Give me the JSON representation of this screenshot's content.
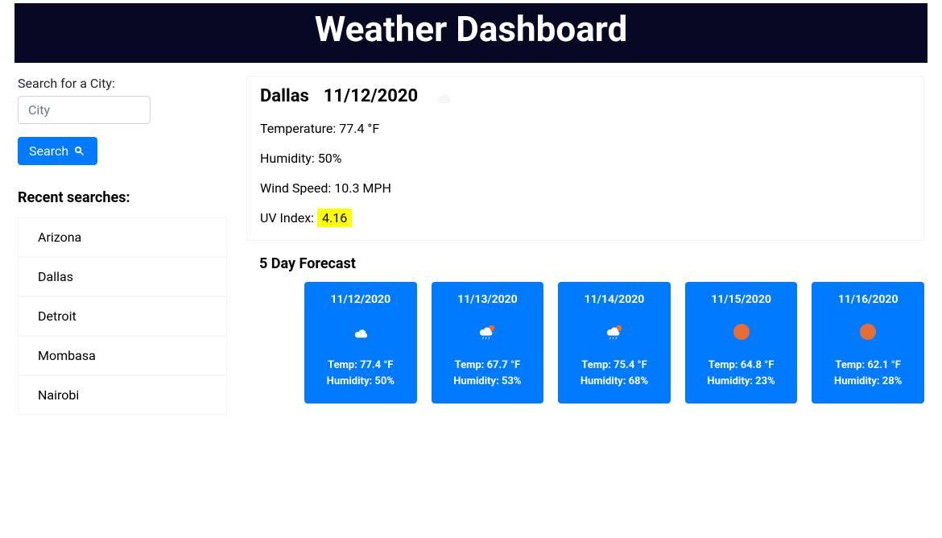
{
  "header": {
    "title": "Weather Dashboard"
  },
  "sidebar": {
    "search_label": "Search for a City:",
    "city_placeholder": "City",
    "search_button": "Search",
    "recent_heading": "Recent searches:",
    "recent": [
      "Arizona",
      "Dallas",
      "Detroit",
      "Mombasa",
      "Nairobi"
    ]
  },
  "current": {
    "city": "Dallas",
    "date": "11/12/2020",
    "icon": "cloud",
    "temp_label": "Temperature: ",
    "temp": "77.4 °F",
    "humidity_label": "Humidity: ",
    "humidity": "50%",
    "wind_label": "Wind Speed: ",
    "wind": "10.3 MPH",
    "uv_label": "UV Index: ",
    "uv": "4.16"
  },
  "forecast": {
    "heading": "5 Day Forecast",
    "days": [
      {
        "date": "11/12/2020",
        "icon": "cloud",
        "temp": "Temp: 77.4 °F",
        "hum": "Humidity: 50%"
      },
      {
        "date": "11/13/2020",
        "icon": "rain-cloud",
        "temp": "Temp: 67.7 °F",
        "hum": "Humidity: 53%"
      },
      {
        "date": "11/14/2020",
        "icon": "rain-cloud",
        "temp": "Temp: 75.4 °F",
        "hum": "Humidity: 68%"
      },
      {
        "date": "11/15/2020",
        "icon": "sun",
        "temp": "Temp: 64.8 °F",
        "hum": "Humidity: 23%"
      },
      {
        "date": "11/16/2020",
        "icon": "sun",
        "temp": "Temp: 62.1 °F",
        "hum": "Humidity: 28%"
      }
    ]
  }
}
